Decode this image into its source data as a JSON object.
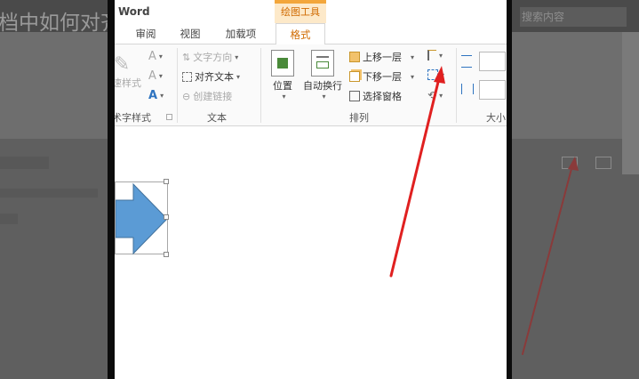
{
  "background": {
    "title_fragment": "档中如何对齐",
    "search_placeholder": "搜索内容",
    "ribbon_fragments": [
      "窗格",
      "大小"
    ]
  },
  "app": {
    "title": "Word",
    "contextual_tab_group": "绘图工具"
  },
  "tabs": [
    {
      "label": "审阅",
      "active": false
    },
    {
      "label": "视图",
      "active": false
    },
    {
      "label": "加载项",
      "active": false
    },
    {
      "label": "格式",
      "active": true
    }
  ],
  "ribbon": {
    "art_styles": {
      "label": "艺术字样式",
      "quick_styles": "快速样式",
      "text_fill_icon": "A",
      "text_outline_icon": "A",
      "text_effects_icon": "A"
    },
    "text_group": {
      "label": "文本",
      "direction": "文字方向",
      "align": "对齐文本",
      "link": "创建链接"
    },
    "arrange_group": {
      "label": "排列",
      "position": "位置",
      "wrap": "自动换行",
      "bring_forward": "上移一层",
      "send_backward": "下移一层",
      "selection_pane": "选择窗格"
    },
    "size_group": {
      "label": "大小"
    }
  },
  "colors": {
    "accent_orange": "#d06a00",
    "shape_blue": "#5b9bd5",
    "annotation_red": "#e02020"
  }
}
